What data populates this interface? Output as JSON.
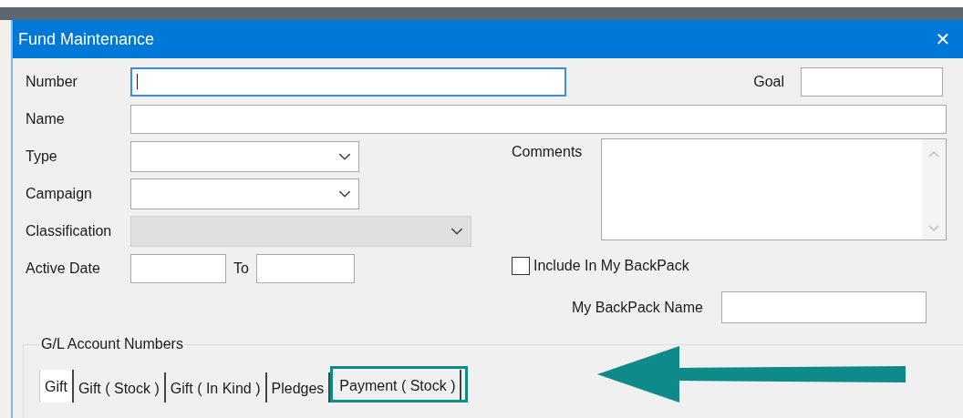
{
  "window": {
    "title": "Fund Maintenance",
    "close": "✕"
  },
  "fields": {
    "number": {
      "label": "Number",
      "focused": true
    },
    "goal": {
      "label": "Goal"
    },
    "name": {
      "label": "Name"
    },
    "type": {
      "label": "Type",
      "disabled": false
    },
    "campaign": {
      "label": "Campaign",
      "disabled": false
    },
    "classification": {
      "label": "Classification",
      "disabled": true
    },
    "active_date": {
      "label": "Active Date"
    },
    "to": {
      "label": "To"
    },
    "comments": {
      "label": "Comments"
    },
    "include_backpack": {
      "label": "Include In My BackPack",
      "checked": false
    },
    "backpack_name": {
      "label": "My BackPack Name"
    }
  },
  "gl_group": {
    "title": "G/L Account Numbers",
    "tabs": [
      {
        "label": "Gift",
        "selected": true
      },
      {
        "label": "Gift ( Stock )",
        "selected": false
      },
      {
        "label": "Gift ( In Kind )",
        "selected": false
      },
      {
        "label": "Pledges",
        "selected": false
      },
      {
        "label": "Payment ( Stock )",
        "selected": false,
        "highlighted": true
      }
    ]
  }
}
